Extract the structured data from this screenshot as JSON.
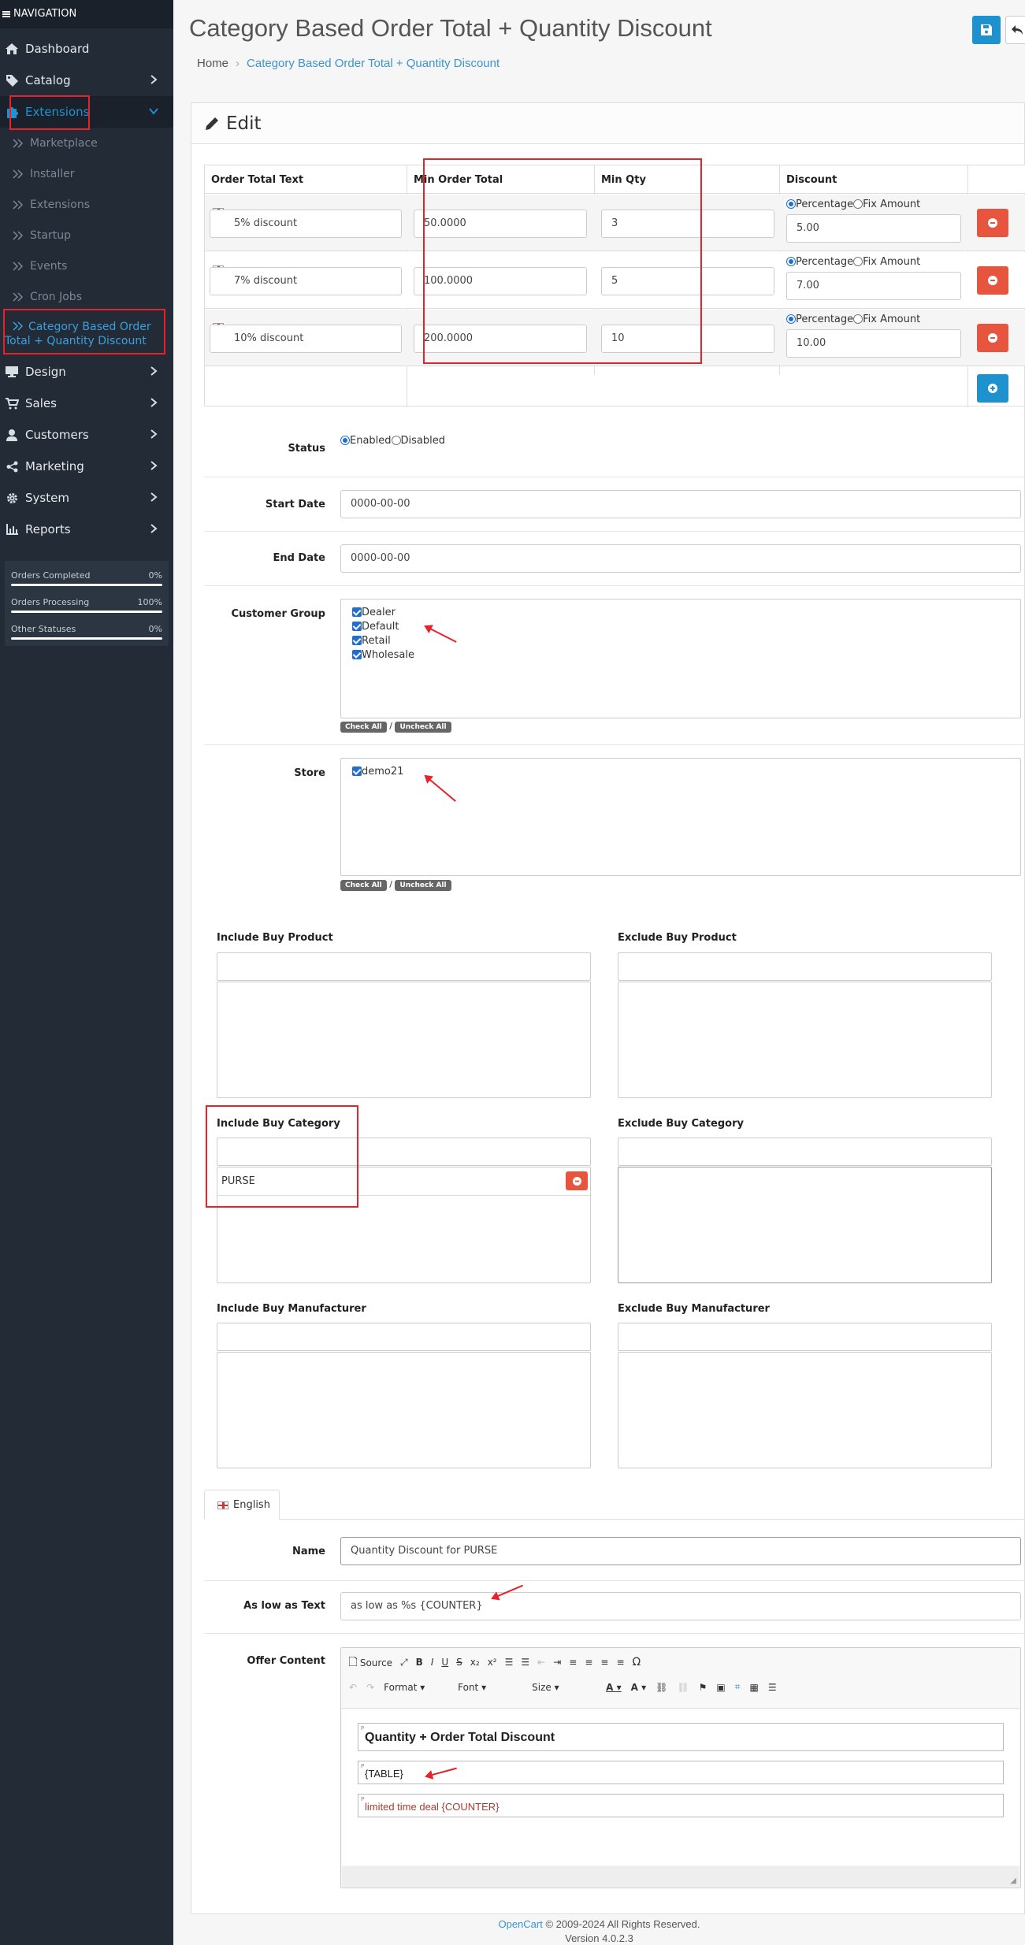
{
  "sidebar": {
    "heading": "NAVIGATION",
    "items": [
      {
        "label": "Dashboard"
      },
      {
        "label": "Catalog"
      },
      {
        "label": "Extensions"
      }
    ],
    "sub_items": [
      "Marketplace",
      "Installer",
      "Extensions",
      "Startup",
      "Events",
      "Cron Jobs",
      "Category Based Order Total + Quantity Discount"
    ],
    "items_bottom": [
      "Design",
      "Sales",
      "Customers",
      "Marketing",
      "System",
      "Reports"
    ],
    "stats": [
      {
        "label": "Orders Completed",
        "value": "0%"
      },
      {
        "label": "Orders Processing",
        "value": "100%"
      },
      {
        "label": "Other Statuses",
        "value": "0%"
      }
    ]
  },
  "header": {
    "title": "Category Based Order Total + Quantity Discount",
    "breadcrumb": [
      "Home",
      "Category Based Order Total + Quantity Discount"
    ]
  },
  "panel": {
    "title": "Edit"
  },
  "discount_table": {
    "headers": [
      "Order Total Text",
      "Min Order Total",
      "Min Qty",
      "Discount"
    ],
    "rows": [
      {
        "text": "5% discount",
        "min_total": "50.0000",
        "min_qty": "3",
        "amount": "5.00"
      },
      {
        "text": "7% discount",
        "min_total": "100.0000",
        "min_qty": "5",
        "amount": "7.00"
      },
      {
        "text": "10% discount",
        "min_total": "200.0000",
        "min_qty": "10",
        "amount": "10.00"
      }
    ],
    "radio_percentage": "Percentage",
    "radio_fixed": "Fix Amount"
  },
  "form": {
    "status_label": "Status",
    "status_enabled": "Enabled",
    "status_disabled": "Disabled",
    "start_label": "Start Date",
    "start_value": "0000-00-00",
    "end_label": "End Date",
    "end_value": "0000-00-00",
    "group_label": "Customer Group",
    "groups": [
      "Dealer",
      "Default",
      "Retail",
      "Wholesale"
    ],
    "store_label": "Store",
    "stores": [
      "demo21"
    ],
    "check_all": "Check All",
    "uncheck_all": "Uncheck All",
    "slash": "/",
    "inc_product": "Include Buy Product",
    "exc_product": "Exclude Buy Product",
    "inc_category": "Include Buy Category",
    "exc_category": "Exclude Buy Category",
    "category_item": "PURSE",
    "inc_manufacturer": "Include Buy Manufacturer",
    "exc_manufacturer": "Exclude Buy Manufacturer",
    "lang_tab": "English",
    "name_label": "Name",
    "name_value": "Quantity Discount for PURSE",
    "aslow_label": "As low as Text",
    "aslow_value": "as low as %s {COUNTER}",
    "offer_label": "Offer Content"
  },
  "editor": {
    "source": "Source",
    "format": "Format",
    "font": "Font",
    "size": "Size",
    "p_marker": "P",
    "content_title": "Quantity + Order Total Discount",
    "content_table": "{TABLE}",
    "content_deal": "limited time deal {COUNTER}"
  },
  "footer": {
    "brand": "OpenCart",
    "copyright": "© 2009-2024 All Rights Reserved.",
    "version": "Version 4.0.2.3"
  }
}
